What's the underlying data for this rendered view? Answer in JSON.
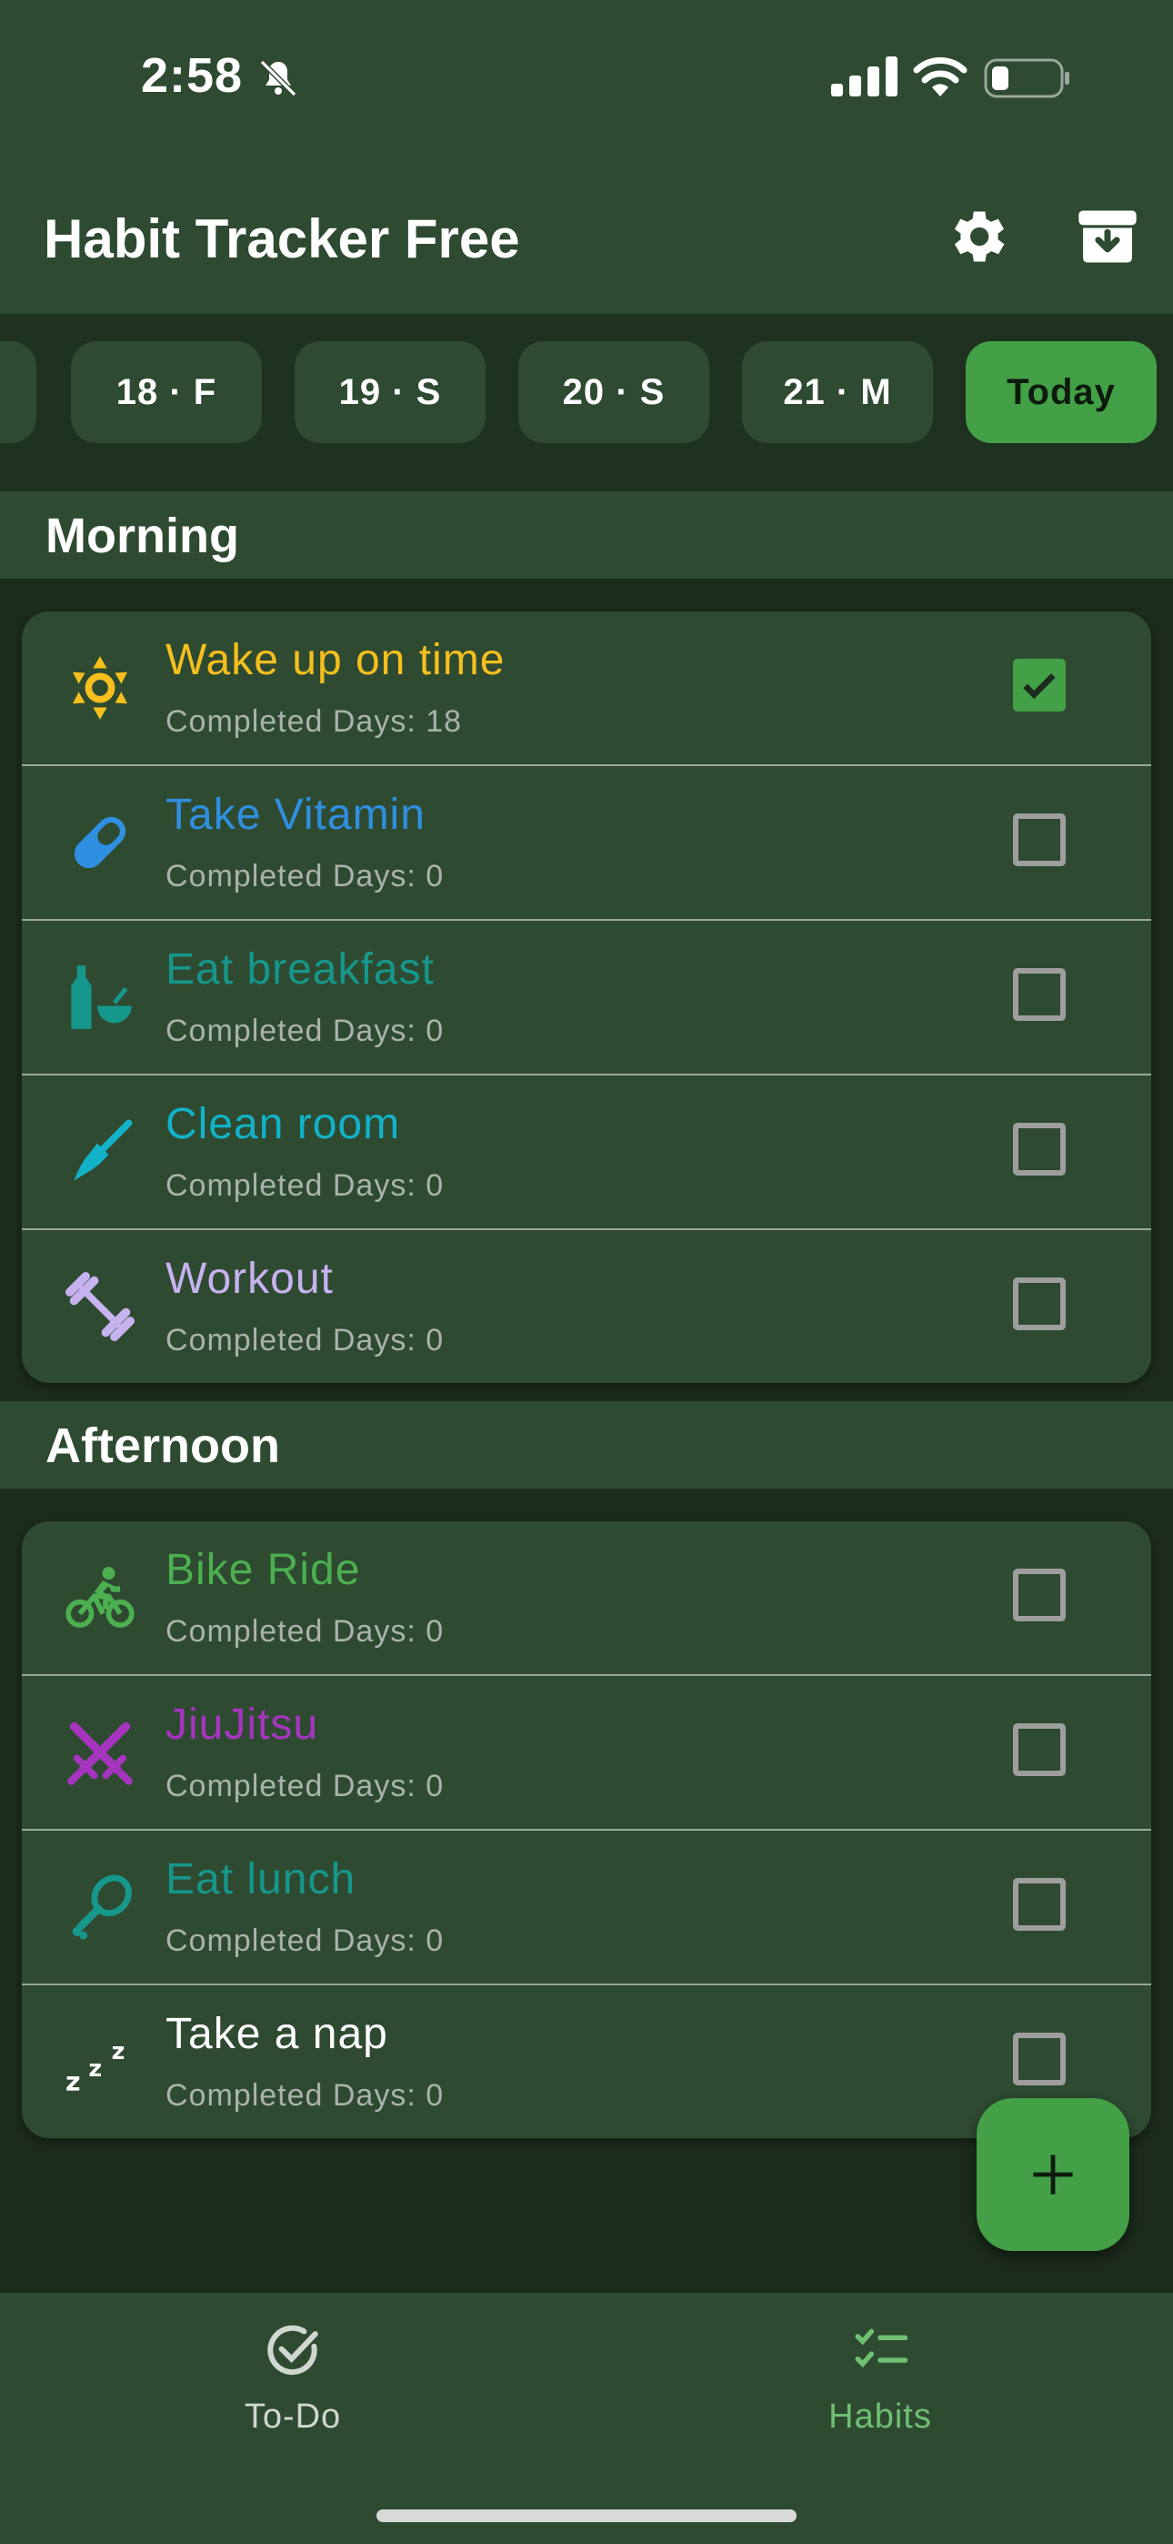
{
  "status_bar": {
    "time": "2:58",
    "icons": [
      "bell-slash-icon",
      "signal-icon",
      "wifi-icon",
      "battery-icon"
    ]
  },
  "header": {
    "title": "Habit Tracker Free",
    "actions": [
      "settings-icon",
      "archive-icon"
    ]
  },
  "dates": [
    {
      "label": "18 · F",
      "active": false
    },
    {
      "label": "19 · S",
      "active": false
    },
    {
      "label": "20 · S",
      "active": false
    },
    {
      "label": "21 · M",
      "active": false
    },
    {
      "label": "Today",
      "active": true
    }
  ],
  "sections": [
    {
      "title": "Morning",
      "habits": [
        {
          "name": "Wake up on time",
          "subtitle": "Completed Days: 18",
          "color": "#f5bf1e",
          "icon": "sun-icon",
          "checked": true
        },
        {
          "name": "Take Vitamin",
          "subtitle": "Completed Days: 0",
          "color": "#2f8fe0",
          "icon": "pill-icon",
          "checked": false
        },
        {
          "name": "Eat breakfast",
          "subtitle": "Completed Days: 0",
          "color": "#16978b",
          "icon": "bottle-bowl-icon",
          "checked": false
        },
        {
          "name": "Clean room",
          "subtitle": "Completed Days: 0",
          "color": "#12b2c8",
          "icon": "broom-icon",
          "checked": false
        },
        {
          "name": "Workout",
          "subtitle": "Completed Days: 0",
          "color": "#c7b2f0",
          "icon": "dumbbell-icon",
          "checked": false
        }
      ]
    },
    {
      "title": "Afternoon",
      "habits": [
        {
          "name": "Bike Ride",
          "subtitle": "Completed Days: 0",
          "color": "#4caf50",
          "icon": "bike-icon",
          "checked": false
        },
        {
          "name": "JiuJitsu",
          "subtitle": "Completed Days: 0",
          "color": "#a535bf",
          "icon": "crossed-swords-icon",
          "checked": false
        },
        {
          "name": "Eat lunch",
          "subtitle": "Completed Days: 0",
          "color": "#16978b",
          "icon": "drumstick-icon",
          "checked": false
        },
        {
          "name": "Take a nap",
          "subtitle": "Completed Days: 0",
          "color": "#ffffff",
          "icon": "zzz-icon",
          "checked": false
        }
      ]
    }
  ],
  "fab": {
    "icon": "plus-icon"
  },
  "nav": [
    {
      "label": "To-Do",
      "icon": "check-circle-icon",
      "active": false
    },
    {
      "label": "Habits",
      "icon": "checklist-icon",
      "active": true
    }
  ],
  "colors": {
    "primary": "#43a047",
    "surface": "#2e4a31",
    "background": "#1b2b1c",
    "active_nav": "#6fbf73",
    "inactive_nav": "#d0d6d0"
  }
}
